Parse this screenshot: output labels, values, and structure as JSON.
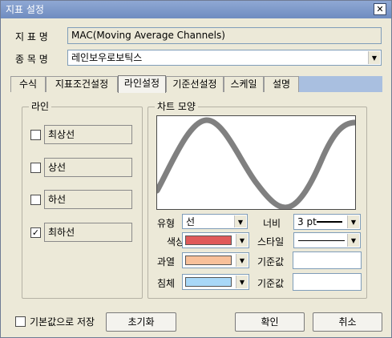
{
  "window": {
    "title": "지표 설정",
    "close_glyph": "✕"
  },
  "form": {
    "indicator_label": "지 표 명",
    "indicator_value": "MAC(Moving Average Channels)",
    "stock_label": "종 목 명",
    "stock_value": "레인보우로보틱스"
  },
  "tabs": [
    {
      "label": "수식"
    },
    {
      "label": "지표조건설정"
    },
    {
      "label": "라인설정",
      "active": true
    },
    {
      "label": "기준선설정"
    },
    {
      "label": "스케일"
    },
    {
      "label": "설명"
    }
  ],
  "lines_group": {
    "title": "라인",
    "items": [
      {
        "label": "최상선",
        "checked": false,
        "mark": ""
      },
      {
        "label": "상선",
        "checked": false,
        "mark": ""
      },
      {
        "label": "하선",
        "checked": false,
        "mark": ""
      },
      {
        "label": "최하선",
        "checked": true,
        "mark": "✓"
      }
    ]
  },
  "chart_group": {
    "title": "차트 모양",
    "type_label": "유형",
    "type_value": "선",
    "width_label": "너비",
    "width_value": "3 pt",
    "color_label": "색상",
    "color_value": "#e05a5a",
    "style_label": "스타일",
    "overbought_label": "과열",
    "overbought_color": "#f8c09a",
    "oversold_label": "침체",
    "oversold_color": "#a8d8f8",
    "base1_label": "기준값",
    "base1_value": "",
    "base2_label": "기준값",
    "base2_value": "",
    "preview_line_color": "#808080"
  },
  "footer": {
    "save_default_label": "기본값으로 저장",
    "reset_button": "초기화",
    "ok_button": "확인",
    "cancel_button": "취소"
  }
}
